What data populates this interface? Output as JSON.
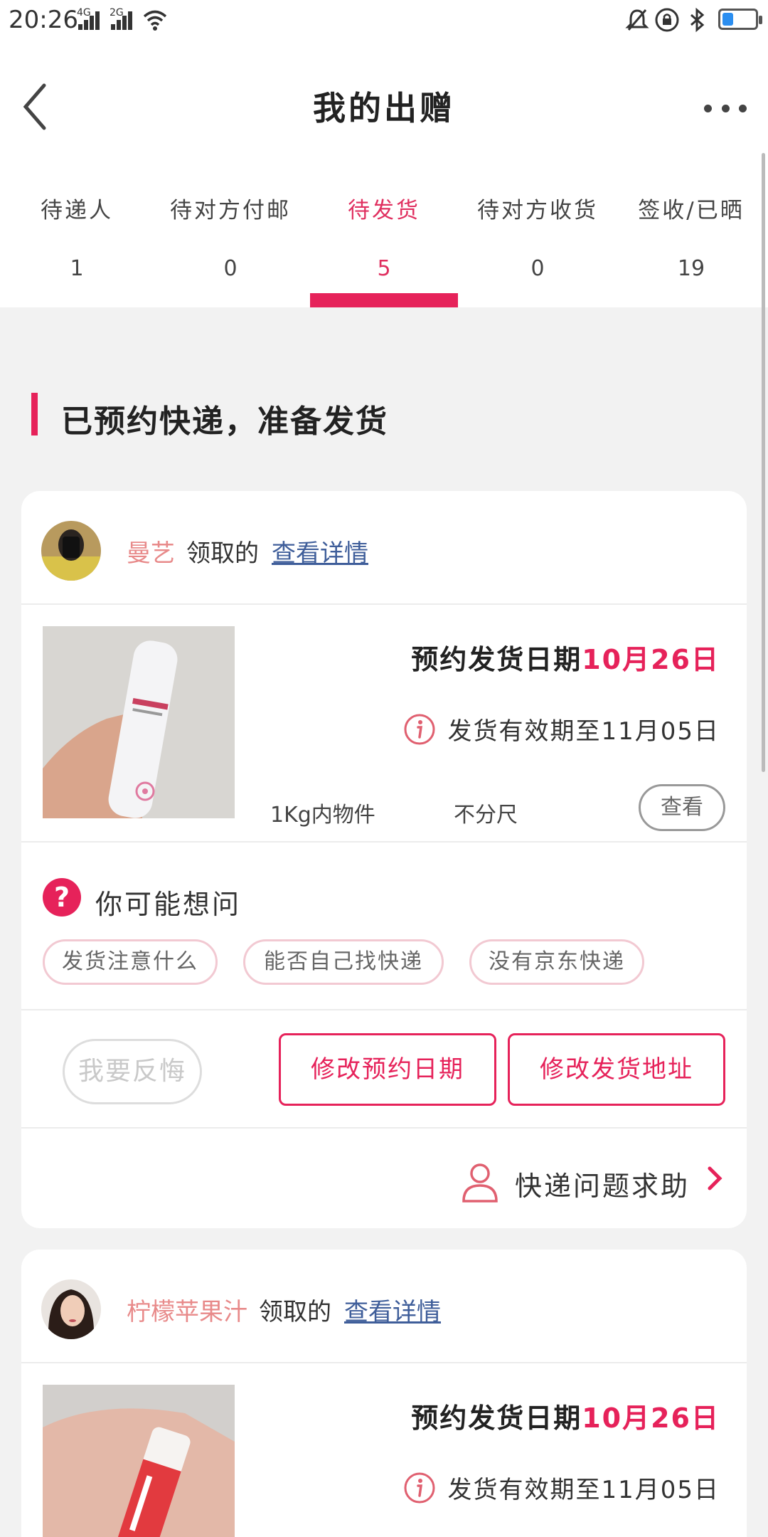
{
  "status_bar": {
    "time": "20:26",
    "network_1": "4G",
    "network_2": "2G",
    "icons": [
      "signal-icon",
      "signal-icon",
      "wifi-icon",
      "mute-icon",
      "lock-rotation-icon",
      "bluetooth-icon",
      "battery-icon"
    ],
    "battery_level": 0.35
  },
  "header": {
    "title": "我的出赠",
    "back_icon": "chevron-left-icon",
    "more_icon": "more-horizontal-icon"
  },
  "tabs": [
    {
      "label": "待递人",
      "count": "1"
    },
    {
      "label": "待对方付邮",
      "count": "0"
    },
    {
      "label": "待发货",
      "count": "5",
      "active": true
    },
    {
      "label": "待对方收货",
      "count": "0"
    },
    {
      "label": "签收/已晒",
      "count": "19"
    }
  ],
  "section": {
    "title": "已预约快递，准备发货"
  },
  "colors": {
    "accent": "#e6225a",
    "receiver_name": "#e88a8a",
    "link": "#3f5e9a",
    "background": "#f2f2f2"
  },
  "cards": [
    {
      "receiver": "曼艺",
      "claimed": "领取的",
      "detail_link": "查看详情",
      "ship_date_label": "预约发货日期",
      "ship_date": "10月26日",
      "valid_until": "发货有效期至11月05日",
      "weight": "1Kg内物件",
      "size": "不分尺",
      "view_button": "查看",
      "faq_title": "你可能想问",
      "faq_chips": [
        "发货注意什么",
        "能否自己找快递",
        "没有京东快递"
      ],
      "regret_button": "我要反悔",
      "modify_date_button": "修改预约日期",
      "modify_address_button": "修改发货地址",
      "help_text": "快递问题求助"
    },
    {
      "receiver": "柠檬苹果汁",
      "claimed": "领取的",
      "detail_link": "查看详情",
      "ship_date_label": "预约发货日期",
      "ship_date": "10月26日",
      "valid_until": "发货有效期至11月05日"
    }
  ]
}
